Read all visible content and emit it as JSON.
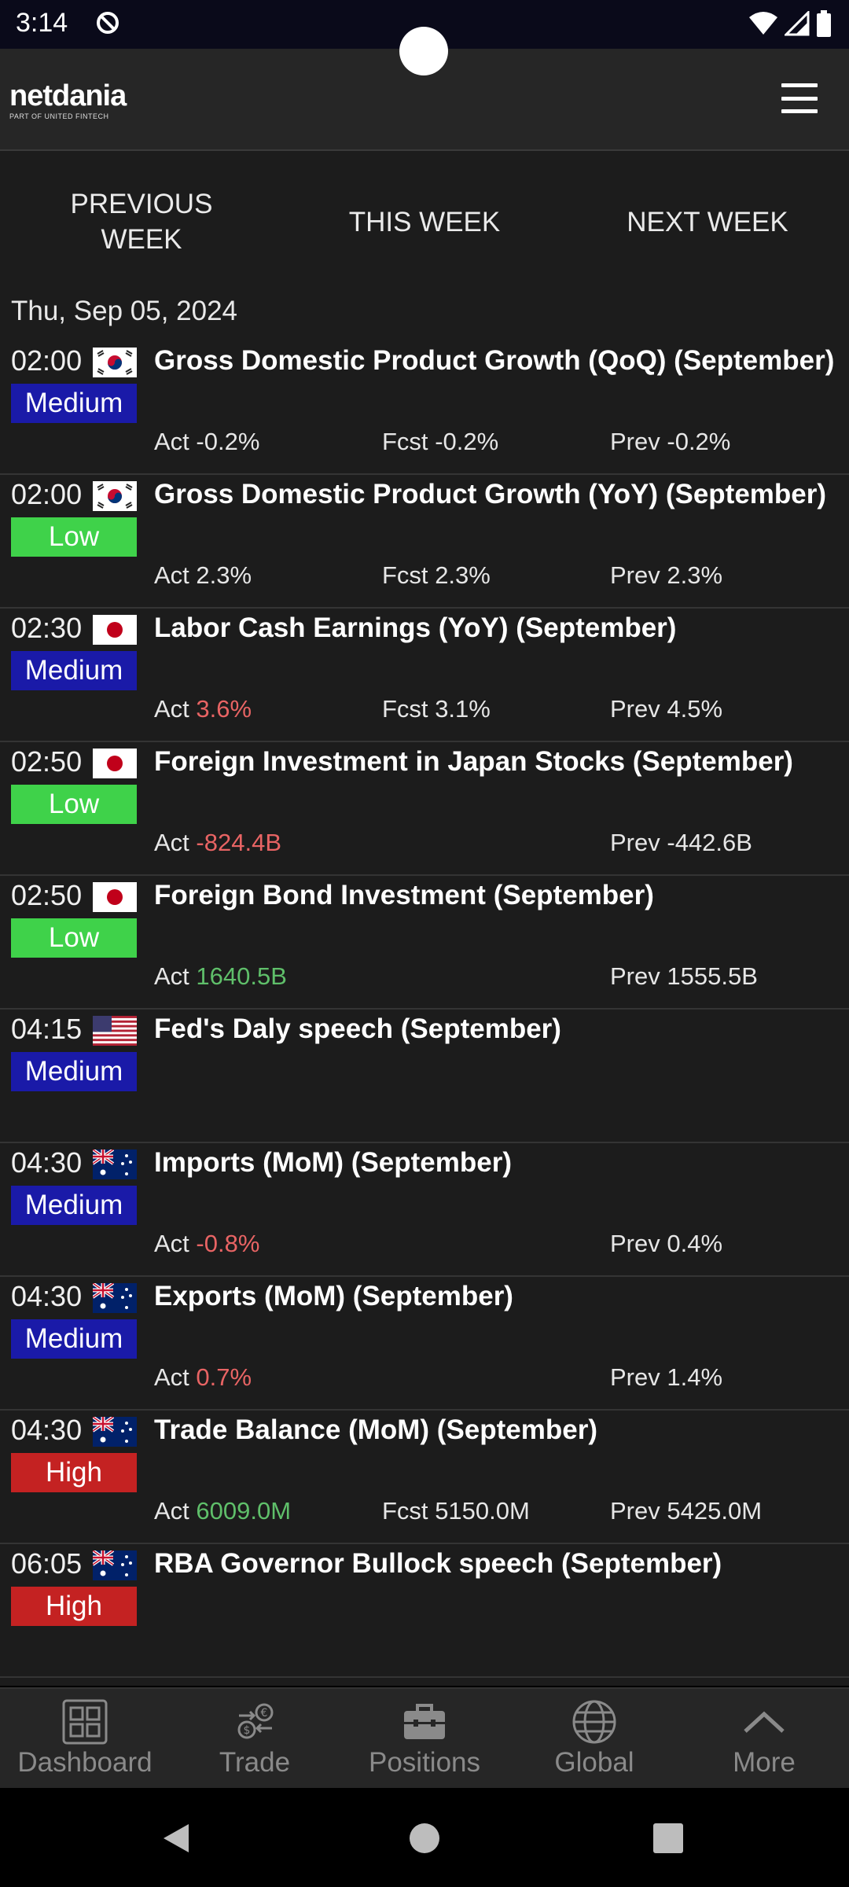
{
  "status_bar": {
    "time": "3:14"
  },
  "header": {
    "logo_main": "netdania",
    "logo_sub": "PART OF UNITED FINTECH"
  },
  "week_tabs": [
    {
      "label": "PREVIOUS\nWEEK"
    },
    {
      "label": "THIS WEEK"
    },
    {
      "label": "NEXT WEEK"
    }
  ],
  "date_heading": "Thu, Sep 05, 2024",
  "impact_colors": {
    "Medium": "#1a1aa8",
    "Low": "#3fd24a",
    "High": "#c42222"
  },
  "value_colors": {
    "negative": "#e86464",
    "positive": "#5fbf6a",
    "neutral": "#e6e6e6"
  },
  "events": [
    {
      "time": "02:00",
      "country": "KR",
      "impact": "Medium",
      "title": "Gross Domestic Product Growth (QoQ) (September)",
      "act_label": "Act",
      "act": "-0.2%",
      "act_tone": "neutral",
      "fcst_label": "Fcst",
      "fcst": "-0.2%",
      "prev_label": "Prev",
      "prev": "-0.2%"
    },
    {
      "time": "02:00",
      "country": "KR",
      "impact": "Low",
      "title": "Gross Domestic Product Growth (YoY) (September)",
      "act_label": "Act",
      "act": "2.3%",
      "act_tone": "neutral",
      "fcst_label": "Fcst",
      "fcst": "2.3%",
      "prev_label": "Prev",
      "prev": "2.3%"
    },
    {
      "time": "02:30",
      "country": "JP",
      "impact": "Medium",
      "title": "Labor Cash Earnings (YoY) (September)",
      "act_label": "Act",
      "act": "3.6%",
      "act_tone": "negative",
      "fcst_label": "Fcst",
      "fcst": "3.1%",
      "prev_label": "Prev",
      "prev": "4.5%"
    },
    {
      "time": "02:50",
      "country": "JP",
      "impact": "Low",
      "title": "Foreign Investment in Japan Stocks (September)",
      "act_label": "Act",
      "act": "-824.4B",
      "act_tone": "negative",
      "fcst_label": "",
      "fcst": "",
      "prev_label": "Prev",
      "prev": "-442.6B"
    },
    {
      "time": "02:50",
      "country": "JP",
      "impact": "Low",
      "title": "Foreign Bond Investment (September)",
      "act_label": "Act",
      "act": "1640.5B",
      "act_tone": "positive",
      "fcst_label": "",
      "fcst": "",
      "prev_label": "Prev",
      "prev": "1555.5B"
    },
    {
      "time": "04:15",
      "country": "US",
      "impact": "Medium",
      "title": "Fed's Daly speech (September)",
      "act_label": "",
      "act": "",
      "act_tone": "neutral",
      "fcst_label": "",
      "fcst": "",
      "prev_label": "",
      "prev": ""
    },
    {
      "time": "04:30",
      "country": "AU",
      "impact": "Medium",
      "title": "Imports (MoM) (September)",
      "act_label": "Act",
      "act": "-0.8%",
      "act_tone": "negative",
      "fcst_label": "",
      "fcst": "",
      "prev_label": "Prev",
      "prev": "0.4%"
    },
    {
      "time": "04:30",
      "country": "AU",
      "impact": "Medium",
      "title": "Exports (MoM) (September)",
      "act_label": "Act",
      "act": "0.7%",
      "act_tone": "negative",
      "fcst_label": "",
      "fcst": "",
      "prev_label": "Prev",
      "prev": "1.4%"
    },
    {
      "time": "04:30",
      "country": "AU",
      "impact": "High",
      "title": "Trade Balance (MoM) (September)",
      "act_label": "Act",
      "act": "6009.0M",
      "act_tone": "positive",
      "fcst_label": "Fcst",
      "fcst": "5150.0M",
      "prev_label": "Prev",
      "prev": "5425.0M"
    },
    {
      "time": "06:05",
      "country": "AU",
      "impact": "High",
      "title": "RBA Governor Bullock speech (September)",
      "act_label": "",
      "act": "",
      "act_tone": "neutral",
      "fcst_label": "",
      "fcst": "",
      "prev_label": "",
      "prev": ""
    }
  ],
  "bottom_nav": [
    {
      "label": "Dashboard",
      "icon": "dashboard-icon"
    },
    {
      "label": "Trade",
      "icon": "trade-icon"
    },
    {
      "label": "Positions",
      "icon": "briefcase-icon"
    },
    {
      "label": "Global",
      "icon": "globe-icon"
    },
    {
      "label": "More",
      "icon": "chevron-up-icon"
    }
  ]
}
